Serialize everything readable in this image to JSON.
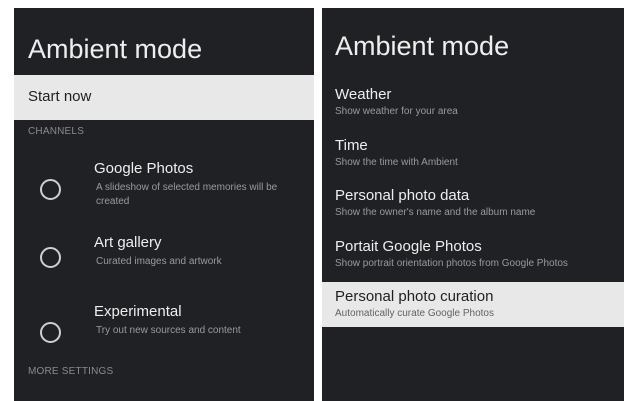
{
  "left_panel": {
    "title": "Ambient mode",
    "start_now": "Start now",
    "channels_header": "CHANNELS",
    "channels": [
      {
        "title": "Google Photos",
        "description": "A slideshow of selected memories will be created",
        "selected": false
      },
      {
        "title": "Art gallery",
        "description": "Curated images and artwork",
        "selected": false
      },
      {
        "title": "Experimental",
        "description": "Try out new sources and content",
        "selected": false
      }
    ],
    "more_settings_header": "MORE SETTINGS"
  },
  "right_panel": {
    "title": "Ambient mode",
    "settings": [
      {
        "title": "Weather",
        "description": "Show weather for your area",
        "focused": false
      },
      {
        "title": "Time",
        "description": "Show the time with Ambient",
        "focused": false
      },
      {
        "title": "Personal photo data",
        "description": "Show the owner's name and the album name",
        "focused": false
      },
      {
        "title": "Portait Google Photos",
        "description": "Show portrait orientation photos from Google Photos",
        "focused": false
      },
      {
        "title": "Personal photo curation",
        "description": "Automatically curate Google Photos",
        "focused": true
      }
    ]
  },
  "colors": {
    "panel_background": "#202124",
    "focus_background": "#e8e8e8",
    "primary_text": "#eeeeee",
    "secondary_text": "#9a9a9a"
  }
}
